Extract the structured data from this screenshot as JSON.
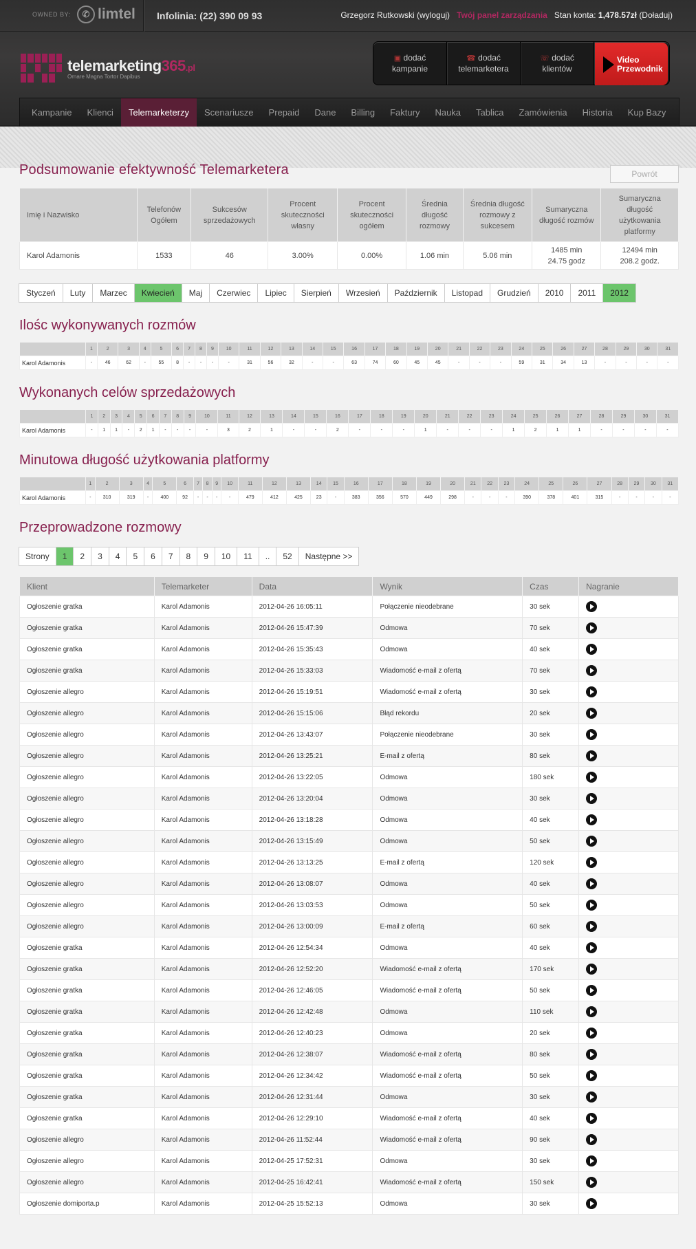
{
  "top": {
    "owned_by": "OWNED BY:",
    "limtel": "limtel",
    "infolinia": "Infolinia: (22) 390 09 93",
    "user": "Grzegorz Rutkowski (wyloguj)",
    "panel": "Twój panel zarządzania",
    "balance_label": "Stan konta:",
    "balance_value": "1,478.57zł",
    "topup": "(Doładuj)"
  },
  "logo": {
    "name_main": "telemarketing",
    "name_accent": "365",
    "tld": ".pl",
    "slogan": "Ornare Magna Tortor Dapibus"
  },
  "actions": [
    {
      "line1": "dodać",
      "line2": "kampanie"
    },
    {
      "line1": "dodać",
      "line2": "telemarketera"
    },
    {
      "line1": "dodać",
      "line2": "klientów"
    }
  ],
  "video": {
    "line1": "Video",
    "line2": "Przewodnik"
  },
  "nav": [
    "Kampanie",
    "Klienci",
    "Telemarketerzy",
    "Scenariusze",
    "Prepaid",
    "Dane",
    "Billing",
    "Faktury",
    "Nauka",
    "Tablica",
    "Zamówienia",
    "Historia",
    "Kup Bazy"
  ],
  "nav_active": 2,
  "summary": {
    "title": "Podsumowanie efektywność Telemarketera",
    "back": "Powrót",
    "headers": [
      "Imię i Nazwisko",
      "Telefonów Ogółem",
      "Sukcesów sprzedażowych",
      "Procent skuteczności własny",
      "Procent skuteczności ogółem",
      "Średnia długość rozmowy",
      "Średnia długość rozmowy z sukcesem",
      "Sumaryczna długość rozmów",
      "Sumaryczna długość użytkowania platformy"
    ],
    "row": [
      "Karol Adamonis",
      "1533",
      "46",
      "3.00%",
      "0.00%",
      "1.06 min",
      "5.06 min",
      "1485 min\n24.75 godz",
      "12494 min\n208.2 godz."
    ]
  },
  "months": [
    "Styczeń",
    "Luty",
    "Marzec",
    "Kwiecień",
    "Maj",
    "Czerwiec",
    "Lipiec",
    "Sierpień",
    "Wrzesień",
    "Październik",
    "Listopad",
    "Grudzień",
    "2010",
    "2011",
    "2012"
  ],
  "months_active": [
    3,
    14
  ],
  "grids": [
    {
      "title": "Ilośc wykonywanych rozmów",
      "name": "Karol Adamonis",
      "values": [
        "-",
        "46",
        "62",
        "-",
        "55",
        "8",
        "-",
        "-",
        "-",
        "-",
        "31",
        "56",
        "32",
        "-",
        "-",
        "63",
        "74",
        "60",
        "45",
        "45",
        "-",
        "-",
        "-",
        "59",
        "31",
        "34",
        "13",
        "-",
        "-",
        "-",
        "-"
      ]
    },
    {
      "title": "Wykonanych celów sprzedażowych",
      "name": "Karol Adamonis",
      "values": [
        "-",
        "1",
        "1",
        "-",
        "2",
        "1",
        "-",
        "-",
        "-",
        "-",
        "3",
        "2",
        "1",
        "-",
        "-",
        "2",
        "-",
        "-",
        "-",
        "1",
        "-",
        "-",
        "-",
        "1",
        "2",
        "1",
        "1",
        "-",
        "-",
        "-",
        "-"
      ]
    },
    {
      "title": "Minutowa długość użytkowania platformy",
      "name": "Karol Adamonis",
      "values": [
        "-",
        "310",
        "319",
        "-",
        "400",
        "92",
        "-",
        "-",
        "-",
        "-",
        "479",
        "412",
        "425",
        "23",
        "-",
        "383",
        "356",
        "570",
        "449",
        "298",
        "-",
        "-",
        "-",
        "390",
        "378",
        "401",
        "315",
        "-",
        "-",
        "-",
        "-"
      ]
    }
  ],
  "calls": {
    "title": "Przeprowadzone rozmowy",
    "pager": [
      "Strony",
      "1",
      "2",
      "3",
      "4",
      "5",
      "6",
      "7",
      "8",
      "9",
      "10",
      "11",
      "..",
      "52",
      "Następne >>"
    ],
    "pager_active": 1,
    "headers": [
      "Klient",
      "Telemarketer",
      "Data",
      "Wynik",
      "Czas",
      "Nagranie"
    ],
    "rows": [
      [
        "Ogłoszenie gratka",
        "Karol Adamonis",
        "2012-04-26 16:05:11",
        "Połączenie nieodebrane",
        "30 sek"
      ],
      [
        "Ogłoszenie gratka",
        "Karol Adamonis",
        "2012-04-26 15:47:39",
        "Odmowa",
        "70 sek"
      ],
      [
        "Ogłoszenie gratka",
        "Karol Adamonis",
        "2012-04-26 15:35:43",
        "Odmowa",
        "40 sek"
      ],
      [
        "Ogłoszenie gratka",
        "Karol Adamonis",
        "2012-04-26 15:33:03",
        "Wiadomość e-mail z ofertą",
        "70 sek"
      ],
      [
        "Ogłoszenie allegro",
        "Karol Adamonis",
        "2012-04-26 15:19:51",
        "Wiadomość e-mail z ofertą",
        "30 sek"
      ],
      [
        "Ogłoszenie allegro",
        "Karol Adamonis",
        "2012-04-26 15:15:06",
        "Błąd rekordu",
        "20 sek"
      ],
      [
        "Ogłoszenie allegro",
        "Karol Adamonis",
        "2012-04-26 13:43:07",
        "Połączenie nieodebrane",
        "30 sek"
      ],
      [
        "Ogłoszenie allegro",
        "Karol Adamonis",
        "2012-04-26 13:25:21",
        "E-mail z ofertą",
        "80 sek"
      ],
      [
        "Ogłoszenie allegro",
        "Karol Adamonis",
        "2012-04-26 13:22:05",
        "Odmowa",
        "180 sek"
      ],
      [
        "Ogłoszenie allegro",
        "Karol Adamonis",
        "2012-04-26 13:20:04",
        "Odmowa",
        "30 sek"
      ],
      [
        "Ogłoszenie allegro",
        "Karol Adamonis",
        "2012-04-26 13:18:28",
        "Odmowa",
        "40 sek"
      ],
      [
        "Ogłoszenie allegro",
        "Karol Adamonis",
        "2012-04-26 13:15:49",
        "Odmowa",
        "50 sek"
      ],
      [
        "Ogłoszenie allegro",
        "Karol Adamonis",
        "2012-04-26 13:13:25",
        "E-mail z ofertą",
        "120 sek"
      ],
      [
        "Ogłoszenie allegro",
        "Karol Adamonis",
        "2012-04-26 13:08:07",
        "Odmowa",
        "40 sek"
      ],
      [
        "Ogłoszenie allegro",
        "Karol Adamonis",
        "2012-04-26 13:03:53",
        "Odmowa",
        "50 sek"
      ],
      [
        "Ogłoszenie allegro",
        "Karol Adamonis",
        "2012-04-26 13:00:09",
        "E-mail z ofertą",
        "60 sek"
      ],
      [
        "Ogłoszenie gratka",
        "Karol Adamonis",
        "2012-04-26 12:54:34",
        "Odmowa",
        "40 sek"
      ],
      [
        "Ogłoszenie gratka",
        "Karol Adamonis",
        "2012-04-26 12:52:20",
        "Wiadomość e-mail z ofertą",
        "170 sek"
      ],
      [
        "Ogłoszenie gratka",
        "Karol Adamonis",
        "2012-04-26 12:46:05",
        "Wiadomość e-mail z ofertą",
        "50 sek"
      ],
      [
        "Ogłoszenie gratka",
        "Karol Adamonis",
        "2012-04-26 12:42:48",
        "Odmowa",
        "110 sek"
      ],
      [
        "Ogłoszenie gratka",
        "Karol Adamonis",
        "2012-04-26 12:40:23",
        "Odmowa",
        "20 sek"
      ],
      [
        "Ogłoszenie gratka",
        "Karol Adamonis",
        "2012-04-26 12:38:07",
        "Wiadomość e-mail z ofertą",
        "80 sek"
      ],
      [
        "Ogłoszenie gratka",
        "Karol Adamonis",
        "2012-04-26 12:34:42",
        "Wiadomość e-mail z ofertą",
        "50 sek"
      ],
      [
        "Ogłoszenie gratka",
        "Karol Adamonis",
        "2012-04-26 12:31:44",
        "Odmowa",
        "30 sek"
      ],
      [
        "Ogłoszenie gratka",
        "Karol Adamonis",
        "2012-04-26 12:29:10",
        "Wiadomość e-mail z ofertą",
        "40 sek"
      ],
      [
        "Ogłoszenie allegro",
        "Karol Adamonis",
        "2012-04-26 11:52:44",
        "Wiadomość e-mail z ofertą",
        "90 sek"
      ],
      [
        "Ogłoszenie allegro",
        "Karol Adamonis",
        "2012-04-25 17:52:31",
        "Odmowa",
        "30 sek"
      ],
      [
        "Ogłoszenie allegro",
        "Karol Adamonis",
        "2012-04-25 16:42:41",
        "Wiadomość e-mail z ofertą",
        "150 sek"
      ],
      [
        "Ogłoszenie domiporta.p",
        "Karol Adamonis",
        "2012-04-25 15:52:13",
        "Odmowa",
        "30 sek"
      ]
    ]
  }
}
